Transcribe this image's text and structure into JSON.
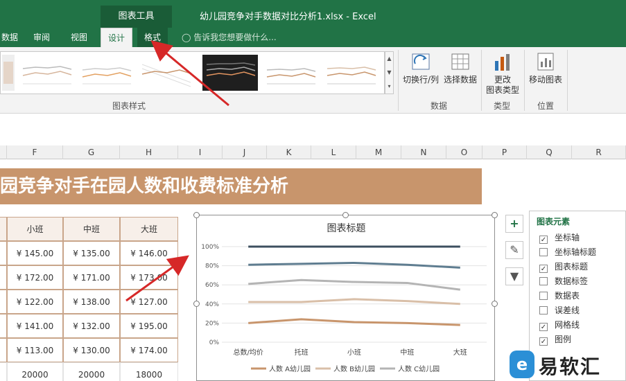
{
  "titlebar": {
    "tool_group": "图表工具",
    "doc_title": "幼儿园竞争对手数据对比分析1.xlsx - Excel"
  },
  "tabs": [
    {
      "label": "数据"
    },
    {
      "label": "审阅"
    },
    {
      "label": "视图"
    },
    {
      "label": "设计"
    },
    {
      "label": "格式"
    }
  ],
  "tell_me": "告诉我您想要做什么...",
  "ribbon": {
    "chart_styles_label": "图表样式",
    "switch_row_col": "切换行/列",
    "select_data": "选择数据",
    "data_group": "数据",
    "change_type_1": "更改",
    "change_type_2": "图表类型",
    "type_group": "类型",
    "move_chart": "移动图表",
    "location_group": "位置"
  },
  "columns": [
    "F",
    "G",
    "H",
    "I",
    "J",
    "K",
    "L",
    "M",
    "N",
    "O",
    "P",
    "Q",
    "R"
  ],
  "banner": "园竞争对手在园人数和收费标准分析",
  "table": {
    "headers": [
      "小班",
      "中班",
      "大班"
    ],
    "rows": [
      [
        "¥  145.00",
        "¥  135.00",
        "¥  146.00"
      ],
      [
        "¥  172.00",
        "¥  171.00",
        "¥  173.00"
      ],
      [
        "¥  122.00",
        "¥  138.00",
        "¥  127.00"
      ],
      [
        "¥  141.00",
        "¥  132.00",
        "¥  195.00"
      ],
      [
        "¥  113.00",
        "¥  130.00",
        "¥  174.00"
      ]
    ],
    "last_row": [
      "20000",
      "20000",
      "18000"
    ]
  },
  "chart_data": {
    "type": "line",
    "title": "图表标题",
    "categories": [
      "总数/均价",
      "托班",
      "小班",
      "中班",
      "大班"
    ],
    "y_tick_labels": [
      "0%",
      "20%",
      "40%",
      "60%",
      "80%",
      "100%"
    ],
    "ylim": [
      0,
      1
    ],
    "grid": true,
    "legend_position": "bottom",
    "series": [
      {
        "name": "人数 A幼儿园",
        "color": "#c8956c",
        "values": [
          0.2,
          0.24,
          0.21,
          0.2,
          0.18
        ]
      },
      {
        "name": "人数 B幼儿园",
        "color": "#d9bfa8",
        "values": [
          0.42,
          0.42,
          0.45,
          0.43,
          0.4
        ]
      },
      {
        "name": "人数 C幼儿园",
        "color": "#b4b4b4",
        "values": [
          0.61,
          0.65,
          0.63,
          0.62,
          0.55
        ]
      },
      {
        "name": "",
        "color": "#5f7d90",
        "values": [
          0.81,
          0.82,
          0.83,
          0.81,
          0.78
        ]
      },
      {
        "name": "",
        "color": "#3c4f5f",
        "values": [
          1.0,
          1.0,
          1.0,
          1.0,
          1.0
        ]
      }
    ]
  },
  "pane": {
    "title": "图表元素",
    "items": [
      {
        "label": "坐标轴",
        "checked": true
      },
      {
        "label": "坐标轴标题",
        "checked": false
      },
      {
        "label": "图表标题",
        "checked": true
      },
      {
        "label": "数据标签",
        "checked": false
      },
      {
        "label": "数据表",
        "checked": false
      },
      {
        "label": "误差线",
        "checked": false
      },
      {
        "label": "网格线",
        "checked": true
      },
      {
        "label": "图例",
        "checked": true
      }
    ]
  },
  "watermark": "易软汇",
  "colors": {
    "excel_green": "#217346",
    "banner": "#c8956c",
    "arrow": "#d62828"
  }
}
